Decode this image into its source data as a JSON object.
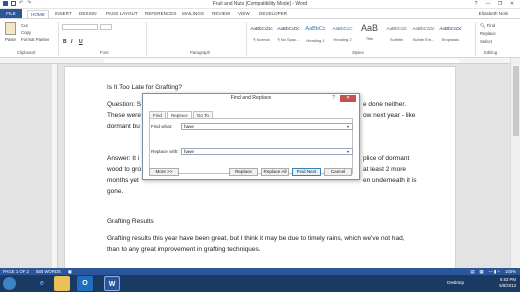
{
  "window": {
    "title": "Fruit and Nuts [Compatibility Mode] - Word",
    "controls": [
      "?",
      "—",
      "❐",
      "✕"
    ]
  },
  "ribbon_tabs": [
    "FILE",
    "HOME",
    "INSERT",
    "DESIGN",
    "PAGE LAYOUT",
    "REFERENCES",
    "MAILINGS",
    "REVIEW",
    "VIEW",
    "DEVELOPER"
  ],
  "user_name": "Elizabeth Nols",
  "ribbon": {
    "clipboard": {
      "paste": "Paste",
      "cut": "Cut",
      "copy": "Copy",
      "format_painter": "Format Painter",
      "label": "Clipboard"
    },
    "font": {
      "label": "Font",
      "bold": "B",
      "italic": "I",
      "underline": "U"
    },
    "paragraph": {
      "label": "Paragraph"
    },
    "styles": {
      "label": "Styles",
      "items": [
        {
          "sample": "AaBbCcDc",
          "name": "¶ Normal"
        },
        {
          "sample": "AaBbCcDc",
          "name": "¶ No Spac..."
        },
        {
          "sample": "AaBbCc",
          "name": "Heading 1"
        },
        {
          "sample": "AaBbCcC",
          "name": "Heading 2"
        },
        {
          "sample": "AaB",
          "name": "Title"
        },
        {
          "sample": "AaBbCcD",
          "name": "Subtitle"
        },
        {
          "sample": "AaBbCcDc",
          "name": "Subtle Em..."
        },
        {
          "sample": "AaBbCcDc",
          "name": "Emphasis"
        }
      ]
    },
    "editing": {
      "label": "Editing",
      "find": "Find",
      "replace": "Replace",
      "select": "Select"
    }
  },
  "document": {
    "title_line": "Is It Too Late for Grafting?",
    "q_line1_left": "Question: S",
    "q_line1_right": "e done neither.",
    "q_line2_left": "These were",
    "q_line2_right": "ow next year - like",
    "q_line3_left": "dormant bu",
    "a_line1_left": "Answer: It i",
    "a_line1_right": "plice of dormant",
    "a_line2_left": "wood to gro",
    "a_line2_right": "at least 2 more",
    "a_line3_left": "months yet",
    "a_line3_right": "en underneath it is",
    "a_line4": "gone.",
    "heading2": "Grafting Results",
    "para2_line1": "Grafting results this year have been great, but I think it may be due to timely rains, which we've not had,",
    "para2_line2": "than to any great improvement in grafting techniques."
  },
  "dialog": {
    "title": "Find and Replace",
    "help": "?",
    "close": "✕",
    "tabs": [
      "Find",
      "Replace",
      "Go To"
    ],
    "active_tab": "Replace",
    "find_label": "Find what:",
    "find_value": "have",
    "replace_label": "Replace with:",
    "replace_value": "have",
    "buttons": {
      "more": "More >>",
      "replace": "Replace",
      "replace_all": "Replace All",
      "find_next": "Find Next",
      "cancel": "Cancel"
    }
  },
  "status_bar": {
    "page": "PAGE 1 OF 2",
    "words": "585 WORDS",
    "zoom": "100%"
  },
  "taskbar": {
    "desktop": "Desktop",
    "time": "6:53 PM",
    "date": "5/8/2013",
    "apps": [
      "ie-icon",
      "explorer-icon",
      "outlook-icon",
      "word-icon"
    ]
  }
}
